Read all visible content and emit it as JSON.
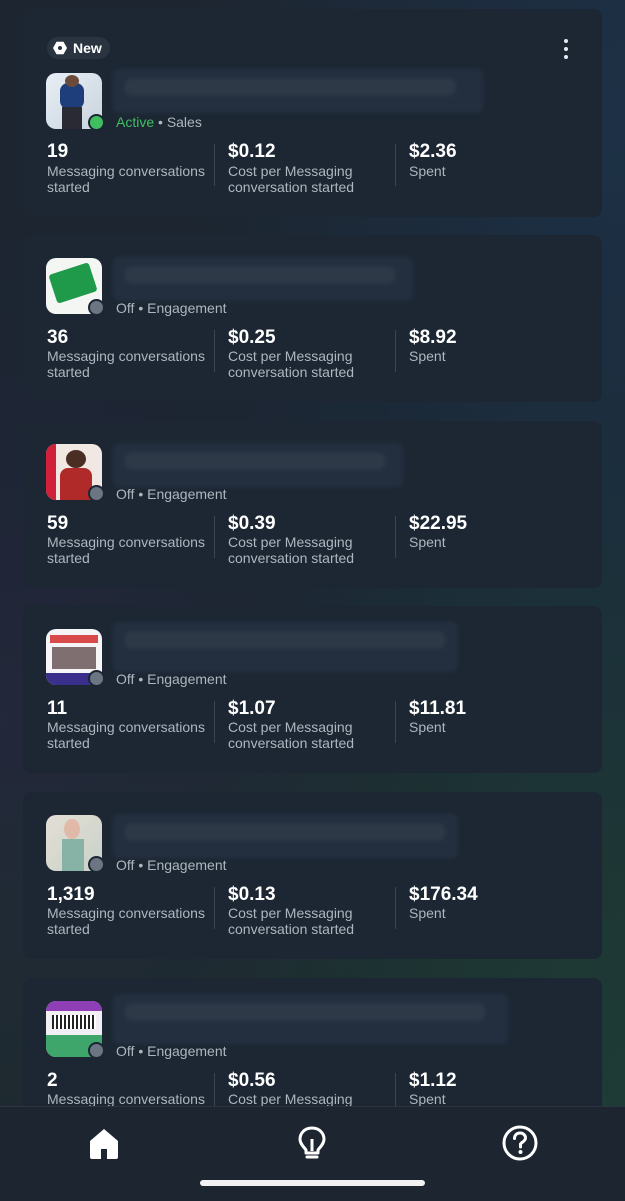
{
  "colors": {
    "background": "#1d2530",
    "card": "#1c2733",
    "active": "#3fbf5f",
    "off_dot": "#6b7583",
    "secondary_text": "#aeb6bf"
  },
  "badge": {
    "label": "New",
    "icon": "new-hex-icon"
  },
  "menu_icon": "more-vertical-icon",
  "ads": [
    {
      "status": "Active",
      "objective": "Sales",
      "results": "19",
      "results_label": "Messaging conversations started",
      "cost": "$0.12",
      "cost_label": "Cost per Messaging conversation started",
      "spent": "$2.36",
      "spent_label": "Spent"
    },
    {
      "status": "Off",
      "objective": "Engagement",
      "results": "36",
      "results_label": "Messaging conversations started",
      "cost": "$0.25",
      "cost_label": "Cost per Messaging conversation started",
      "spent": "$8.92",
      "spent_label": "Spent"
    },
    {
      "status": "Off",
      "objective": "Engagement",
      "results": "59",
      "results_label": "Messaging conversations started",
      "cost": "$0.39",
      "cost_label": "Cost per Messaging conversation started",
      "spent": "$22.95",
      "spent_label": "Spent"
    },
    {
      "status": "Off",
      "objective": "Engagement",
      "results": "11",
      "results_label": "Messaging conversations started",
      "cost": "$1.07",
      "cost_label": "Cost per Messaging conversation started",
      "spent": "$11.81",
      "spent_label": "Spent"
    },
    {
      "status": "Off",
      "objective": "Engagement",
      "results": "1,319",
      "results_label": "Messaging conversations started",
      "cost": "$0.13",
      "cost_label": "Cost per Messaging conversation started",
      "spent": "$176.34",
      "spent_label": "Spent"
    },
    {
      "status": "Off",
      "objective": "Engagement",
      "results": "2",
      "results_label": "Messaging conversations started",
      "cost": "$0.56",
      "cost_label": "Cost per Messaging conversation started",
      "spent": "$1.12",
      "spent_label": "Spent"
    }
  ],
  "separator": "•",
  "nav": [
    {
      "icon": "home-icon"
    },
    {
      "icon": "lightbulb-icon"
    },
    {
      "icon": "help-icon"
    }
  ]
}
